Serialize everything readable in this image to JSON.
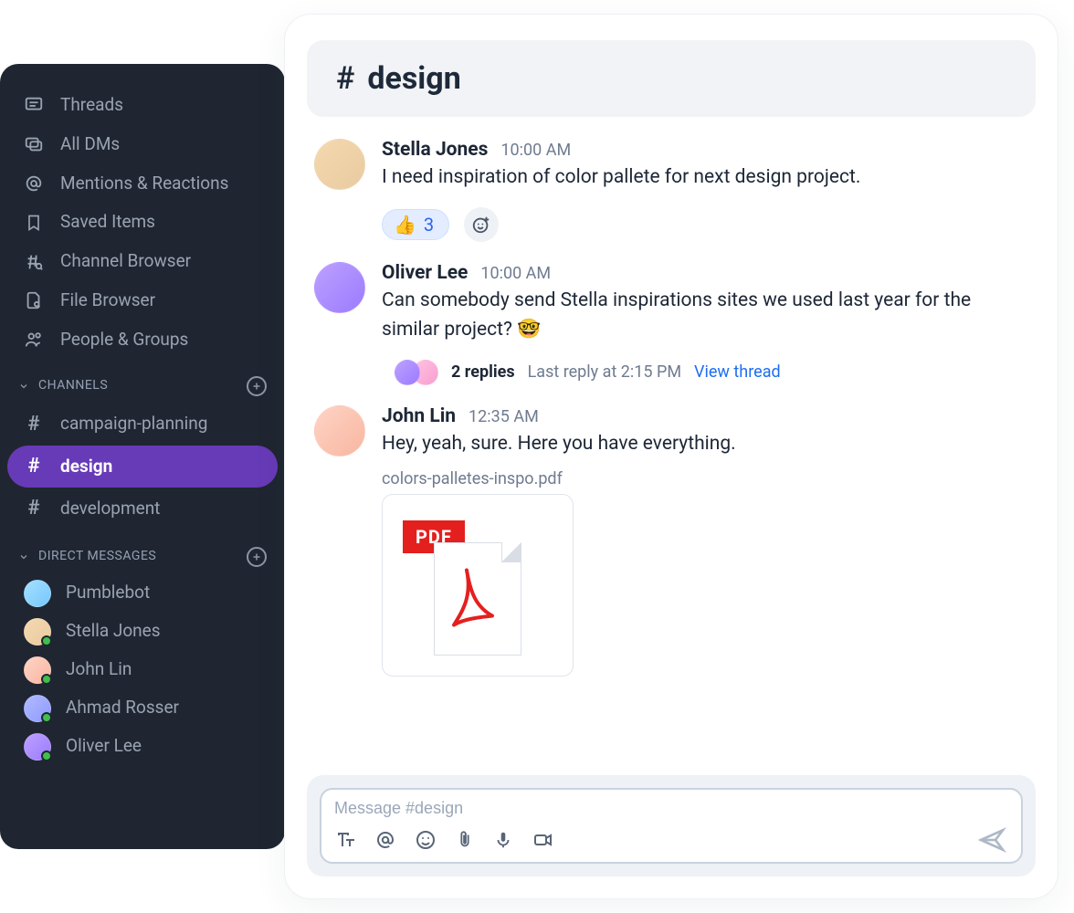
{
  "sidebar": {
    "nav": [
      {
        "label": "Threads"
      },
      {
        "label": "All DMs"
      },
      {
        "label": "Mentions & Reactions"
      },
      {
        "label": "Saved Items"
      },
      {
        "label": "Channel Browser"
      },
      {
        "label": "File Browser"
      },
      {
        "label": "People & Groups"
      }
    ],
    "channels_header": "CHANNELS",
    "channels": [
      {
        "name": "campaign-planning",
        "active": false
      },
      {
        "name": "design",
        "active": true
      },
      {
        "name": "development",
        "active": false
      }
    ],
    "dms_header": "DIRECT MESSAGES",
    "dms": [
      {
        "name": "Pumblebot",
        "online": false
      },
      {
        "name": "Stella Jones",
        "online": true
      },
      {
        "name": "John Lin",
        "online": true
      },
      {
        "name": "Ahmad Rosser",
        "online": true
      },
      {
        "name": "Oliver Lee",
        "online": true
      }
    ]
  },
  "channel": {
    "hash": "#",
    "name": "design"
  },
  "messages": {
    "m0": {
      "author": "Stella Jones",
      "ts": "10:00 AM",
      "body": "I need inspiration of color pallete for next design project.",
      "reaction_emoji": "👍",
      "reaction_count": "3"
    },
    "m1": {
      "author": "Oliver Lee",
      "ts": "10:00 AM",
      "body": "Can somebody send Stella inspirations sites we used last year for the similar project? 🤓",
      "thread": {
        "replies": "2 replies",
        "last": "Last reply at 2:15 PM",
        "view": "View thread"
      }
    },
    "m2": {
      "author": "John Lin",
      "ts": "12:35 AM",
      "body": "Hey, yeah, sure. Here you have everything.",
      "file": {
        "name": "colors-palletes-inspo.pdf",
        "badge": "PDF"
      }
    }
  },
  "composer": {
    "placeholder": "Message #design"
  }
}
